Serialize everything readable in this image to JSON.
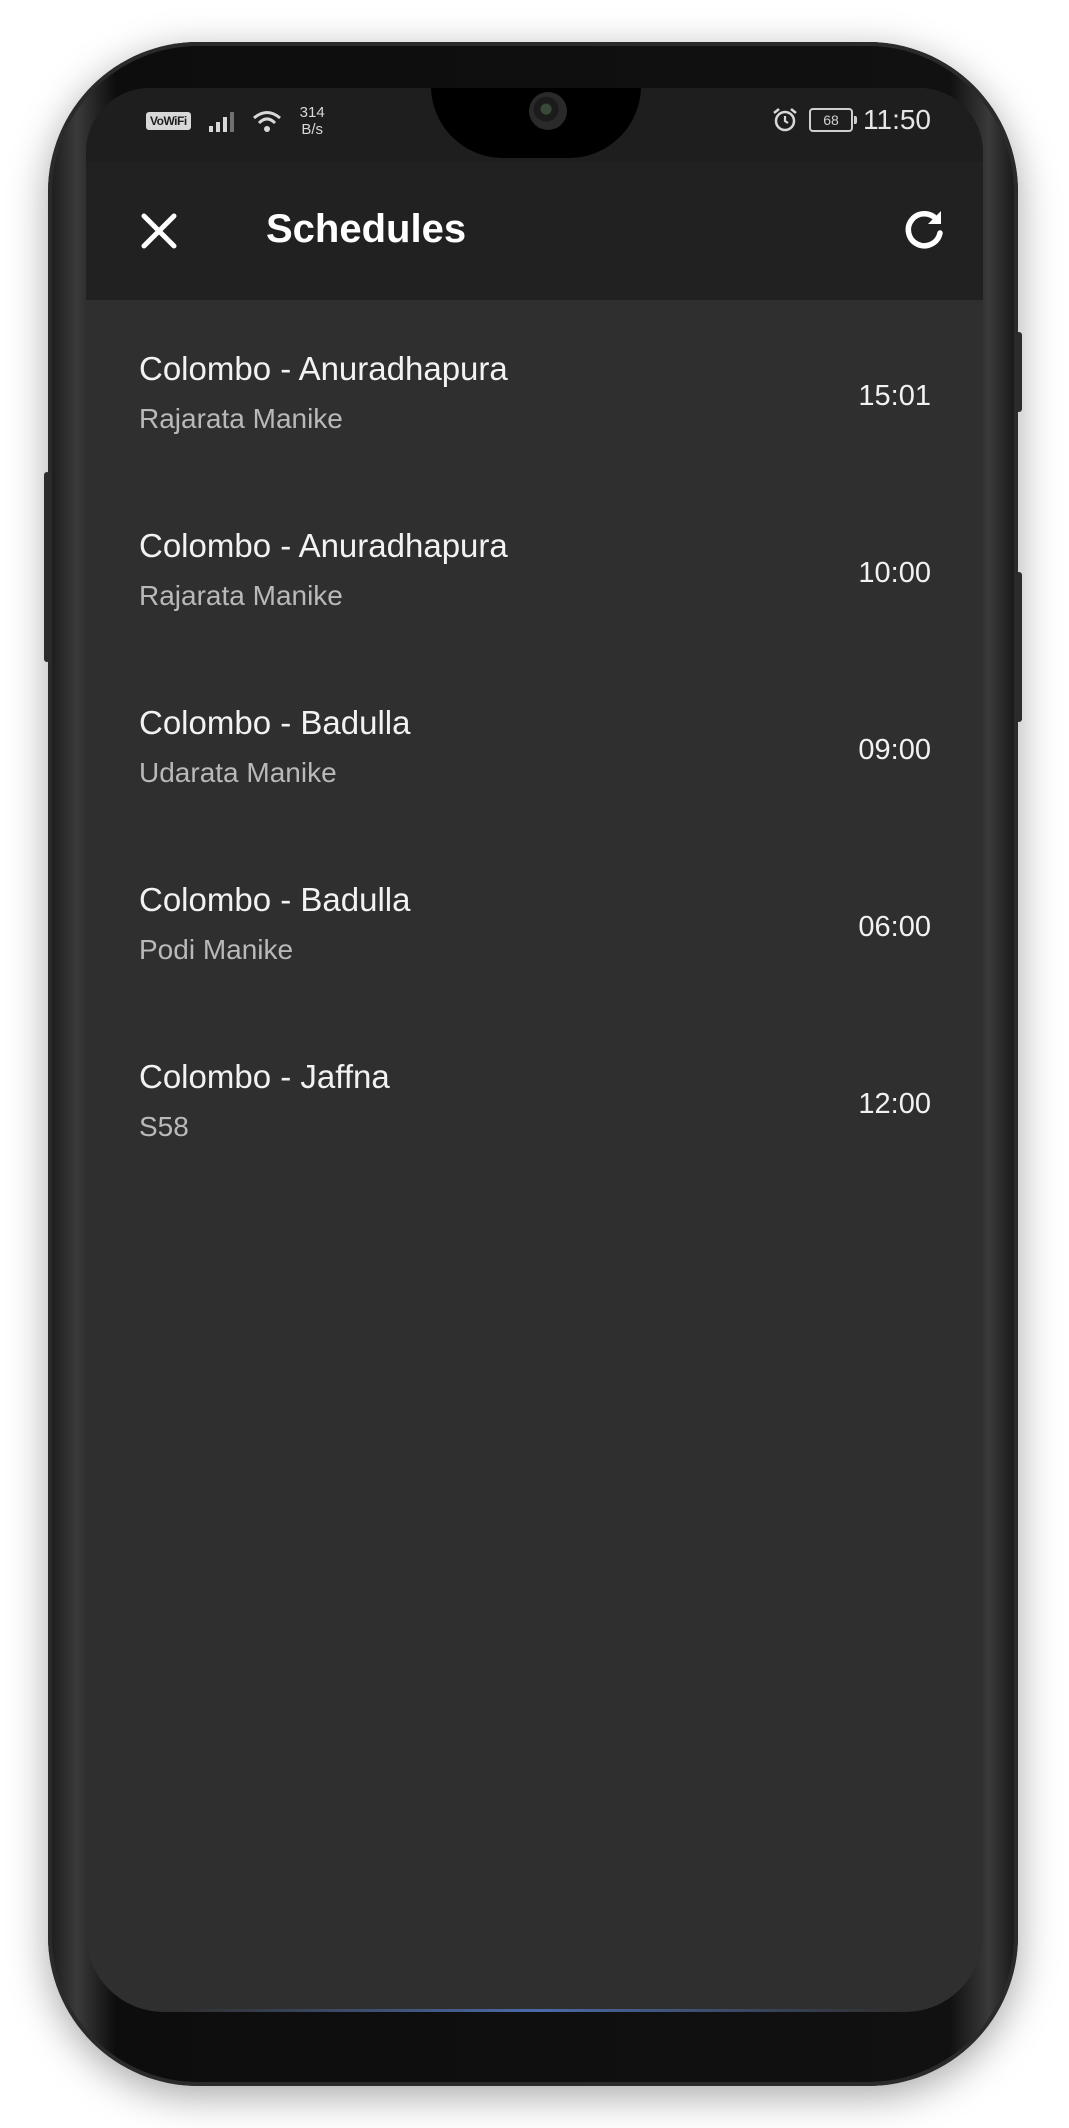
{
  "status_bar": {
    "volte_label": "VoWiFi",
    "net_speed_value": "314",
    "net_speed_unit": "B/s",
    "battery_level": "68",
    "clock": "11:50"
  },
  "app_bar": {
    "title": "Schedules",
    "close_icon": "close-icon",
    "refresh_icon": "refresh-icon"
  },
  "schedules": [
    {
      "route": "Colombo - Anuradhapura",
      "train": "Rajarata Manike",
      "time": "15:01"
    },
    {
      "route": "Colombo - Anuradhapura",
      "train": "Rajarata Manike",
      "time": "10:00"
    },
    {
      "route": "Colombo - Badulla",
      "train": "Udarata Manike",
      "time": "09:00"
    },
    {
      "route": "Colombo - Badulla",
      "train": "Podi Manike",
      "time": "06:00"
    },
    {
      "route": "Colombo - Jaffna",
      "train": "S58",
      "time": "12:00"
    }
  ],
  "colors": {
    "background": "#2f2f2f",
    "app_bar": "#212121",
    "primary_text": "#f2f2f2",
    "secondary_text": "#b9b9b9"
  }
}
